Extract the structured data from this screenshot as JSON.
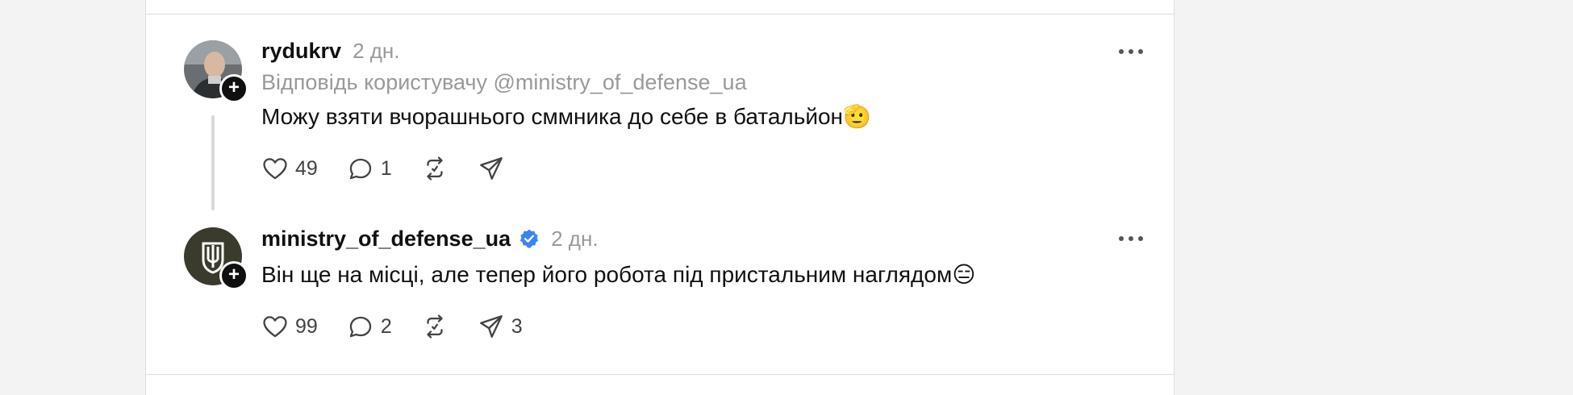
{
  "posts": [
    {
      "username": "rydukrv",
      "time": "2 дн.",
      "reply_to": "Відповідь користувачу @ministry_of_defense_ua",
      "text": "Можу взяти вчорашнього сммника до себе в батальйон",
      "emoji": "🫡",
      "likes": "49",
      "comments": "1",
      "reposts": "",
      "shares": ""
    },
    {
      "username": "ministry_of_defense_ua",
      "verified": true,
      "time": "2 дн.",
      "text": "Він ще на місці, але тепер його робота під пристальним наглядом",
      "emoji": "😑",
      "likes": "99",
      "comments": "2",
      "reposts": "",
      "shares": "3"
    }
  ],
  "icons": {
    "like": "heart-icon",
    "comment": "comment-icon",
    "repost": "repost-icon",
    "share": "send-icon",
    "more": "more-icon",
    "follow": "plus-icon",
    "verified": "verified-badge-icon"
  },
  "colors": {
    "text": "#101010",
    "muted": "#999999",
    "verified": "#3b82f6",
    "divider": "#dcdcdc"
  }
}
